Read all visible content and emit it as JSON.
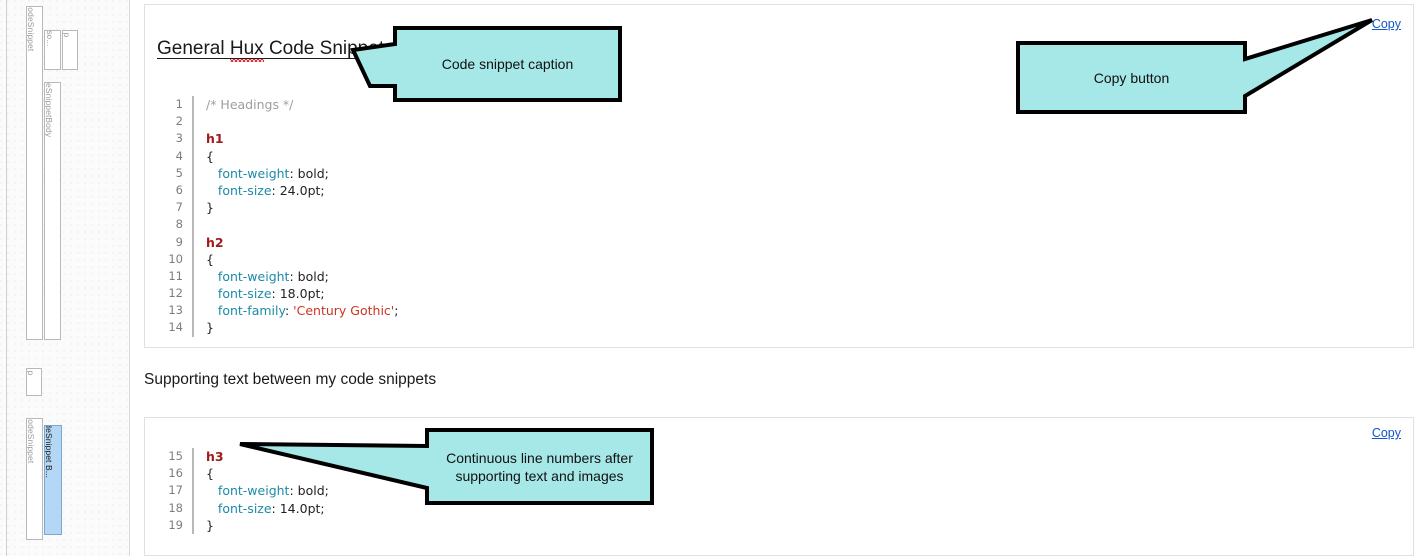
{
  "rail": {
    "items": [
      {
        "label": "MsoCapcodeSnippet",
        "name": "outline-tag-msocapcodesnippet-1",
        "selected": false
      },
      {
        "label": "Mso...",
        "name": "outline-tag-mso-abbrev",
        "selected": false
      },
      {
        "label": "p",
        "name": "outline-tag-p-1",
        "selected": false
      },
      {
        "label": "MsoCapcodeSnippetBody",
        "name": "outline-tag-msocapcodesnippetbody",
        "selected": false
      },
      {
        "label": "p",
        "name": "outline-tag-p-2",
        "selected": false
      },
      {
        "label": "MsoCapcodeSnippet",
        "name": "outline-tag-msocapcodesnippet-2",
        "selected": false
      },
      {
        "label": "MsoCapcodeSnippet B...",
        "name": "outline-tag-msocapcodesnippet-selected",
        "selected": true
      }
    ]
  },
  "snippet_1": {
    "copy_label": "Copy",
    "title_before": "General ",
    "title_misspelled": "Hux",
    "title_after": " Code Snippet",
    "title_full": "General Hux Code Snippet",
    "line_start": 1,
    "lines": [
      [
        {
          "t": "/* Headings */",
          "c": "tok-comment"
        }
      ],
      [],
      [
        {
          "t": "h1",
          "c": "tok-selector"
        }
      ],
      [
        {
          "t": "{",
          "c": "tok-punct"
        }
      ],
      [
        {
          "t": "   ",
          "c": "tok-punct"
        },
        {
          "t": "font-weight",
          "c": "tok-prop"
        },
        {
          "t": ": ",
          "c": "tok-punct"
        },
        {
          "t": "bold;",
          "c": "tok-value"
        }
      ],
      [
        {
          "t": "   ",
          "c": "tok-punct"
        },
        {
          "t": "font-size",
          "c": "tok-prop"
        },
        {
          "t": ": ",
          "c": "tok-punct"
        },
        {
          "t": "24.0pt;",
          "c": "tok-value"
        }
      ],
      [
        {
          "t": "}",
          "c": "tok-punct"
        }
      ],
      [],
      [
        {
          "t": "h2",
          "c": "tok-selector"
        }
      ],
      [
        {
          "t": "{",
          "c": "tok-punct"
        }
      ],
      [
        {
          "t": "   ",
          "c": "tok-punct"
        },
        {
          "t": "font-weight",
          "c": "tok-prop"
        },
        {
          "t": ": ",
          "c": "tok-punct"
        },
        {
          "t": "bold;",
          "c": "tok-value"
        }
      ],
      [
        {
          "t": "   ",
          "c": "tok-punct"
        },
        {
          "t": "font-size",
          "c": "tok-prop"
        },
        {
          "t": ": ",
          "c": "tok-punct"
        },
        {
          "t": "18.0pt;",
          "c": "tok-value"
        }
      ],
      [
        {
          "t": "   ",
          "c": "tok-punct"
        },
        {
          "t": "font-family",
          "c": "tok-prop"
        },
        {
          "t": ": ",
          "c": "tok-punct"
        },
        {
          "t": "'Century Gothic'",
          "c": "tok-string"
        },
        {
          "t": ";",
          "c": "tok-punct"
        }
      ],
      [
        {
          "t": "}",
          "c": "tok-punct"
        }
      ]
    ]
  },
  "support_text": "Supporting text between my code snippets",
  "snippet_2": {
    "copy_label": "Copy",
    "line_start": 15,
    "lines": [
      [
        {
          "t": "h3",
          "c": "tok-selector"
        }
      ],
      [
        {
          "t": "{",
          "c": "tok-punct"
        }
      ],
      [
        {
          "t": "   ",
          "c": "tok-punct"
        },
        {
          "t": "font-weight",
          "c": "tok-prop"
        },
        {
          "t": ": ",
          "c": "tok-punct"
        },
        {
          "t": "bold;",
          "c": "tok-value"
        }
      ],
      [
        {
          "t": "   ",
          "c": "tok-punct"
        },
        {
          "t": "font-size",
          "c": "tok-prop"
        },
        {
          "t": ": ",
          "c": "tok-punct"
        },
        {
          "t": "14.0pt;",
          "c": "tok-value"
        }
      ],
      [
        {
          "t": "}",
          "c": "tok-punct"
        }
      ]
    ]
  },
  "callouts": {
    "caption": {
      "text": "Code snippet caption"
    },
    "copy": {
      "text": "Copy button"
    },
    "linenumbers": {
      "text_line1": "Continuous line numbers after",
      "text_line2": "supporting text and images"
    }
  },
  "colors": {
    "callout_fill": "#A6E7E7",
    "callout_stroke": "#000000",
    "link": "#1155cc",
    "selector": "#a01b1b",
    "property": "#1d8aa8",
    "string": "#cc3322",
    "comment": "#9e9e9e",
    "gutter": "#7d7d7d",
    "selection": "#b3d7f5"
  }
}
